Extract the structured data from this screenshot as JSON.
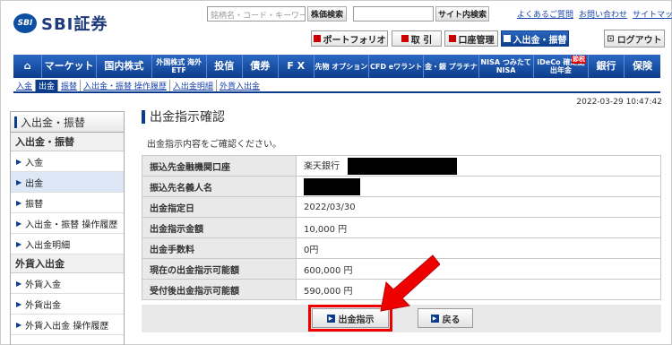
{
  "brand": {
    "logo_mark": "SBI",
    "name": "SBI証券"
  },
  "header": {
    "stock_search_placeholder": "銘柄名・コード・キーワード",
    "stock_search_button": "株価検索",
    "site_search_button": "サイト内検索",
    "links": [
      "よくあるご質問",
      "お問い合わせ",
      "サイトマップ"
    ],
    "nav": [
      "ポートフォリオ",
      "取 引",
      "口座管理",
      "入出金・振替"
    ],
    "logout": "ログアウト"
  },
  "main_nav": [
    "マーケット",
    "国内株式",
    "外国株式 海外ETF",
    "投信",
    "債券",
    "F X",
    "先物 オプション",
    "CFD eワラント",
    "金・銀 プラチナ",
    "NISA つみたてNISA",
    "iDeCo 確定拠出年金",
    "銀行",
    "保険"
  ],
  "ideco_badge": "節税",
  "sub_nav": [
    "入金",
    "出金",
    "振替",
    "入出金・振替 操作履歴",
    "入出金明細",
    "外貨入出金"
  ],
  "timestamp": "2022-03-29 10:47:42",
  "sidebar": {
    "title": "入出金・振替",
    "section1": "入出金・振替",
    "items1": [
      "入金",
      "出金",
      "振替",
      "入出金・振替 操作履歴",
      "入出金明細"
    ],
    "section2": "外貨入出金",
    "items2": [
      "外貨入金",
      "外貨出金",
      "外貨入出金 操作履歴"
    ]
  },
  "page": {
    "title": "出金指示確認",
    "intro": "出金指示内容をご確認ください。",
    "rows": [
      {
        "label": "振込先金融機関口座",
        "value": "楽天銀行"
      },
      {
        "label": "振込先名義人名",
        "value": ""
      },
      {
        "label": "出金指定日",
        "value": "2022/03/30"
      },
      {
        "label": "出金指示金額",
        "value": "10,000 円"
      },
      {
        "label": "出金手数料",
        "value": "0円"
      },
      {
        "label": "現在の出金指示可能額",
        "value": "600,000 円"
      },
      {
        "label": "受付後出金指示可能額",
        "value": "590,000 円"
      }
    ],
    "submit": "出金指示",
    "back": "戻る"
  },
  "colors": {
    "brand_blue": "#0b3d8c",
    "highlight_red": "#e00000"
  }
}
